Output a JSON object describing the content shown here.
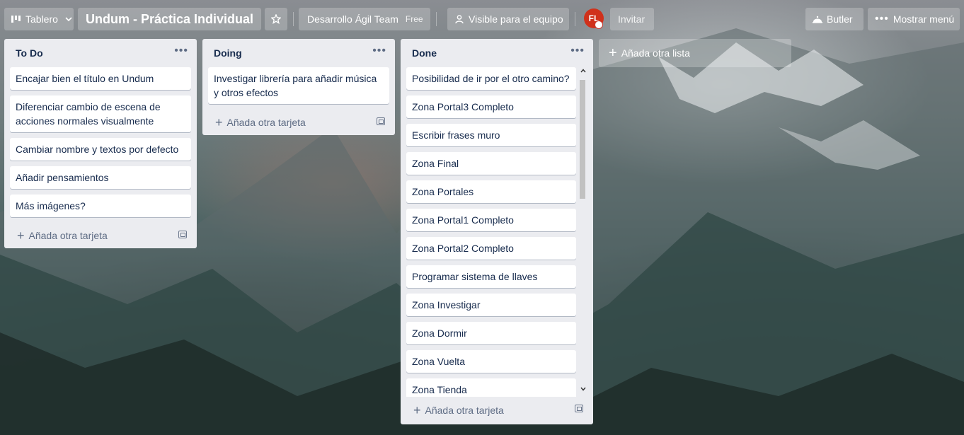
{
  "header": {
    "board_switcher": "Tablero",
    "board_title": "Undum - Práctica Individual",
    "team_name": "Desarrollo Ágil Team",
    "team_plan": "Free",
    "visibility": "Visible para el equipo",
    "avatar_initials": "FL",
    "invite": "Invitar",
    "butler": "Butler",
    "show_menu": "Mostrar menú"
  },
  "lists": [
    {
      "title": "To Do",
      "cards": [
        "Encajar bien el título en Undum",
        "Diferenciar cambio de escena de acciones normales visualmente",
        "Cambiar nombre y textos por defecto",
        "Añadir pensamientos",
        "Más imágenes?"
      ],
      "add_card": "Añada otra tarjeta"
    },
    {
      "title": "Doing",
      "cards": [
        "Investigar librería para añadir música y otros efectos"
      ],
      "add_card": "Añada otra tarjeta"
    },
    {
      "title": "Done",
      "cards": [
        "Posibilidad de ir por el otro camino?",
        "Zona Portal3 Completo",
        "Escribir frases muro",
        "Zona Final",
        "Zona Portales",
        "Zona Portal1 Completo",
        "Zona Portal2 Completo",
        "Programar sistema de llaves",
        "Zona Investigar",
        "Zona Dormir",
        "Zona Vuelta",
        "Zona Tienda"
      ],
      "add_card": "Añada otra tarjeta"
    }
  ],
  "add_list": "Añada otra lista",
  "colors": {
    "list_bg": "#ebecf0",
    "avatar_bg": "#d0311b",
    "text": "#172b4d"
  },
  "icons": {
    "board_switcher": "board-icon",
    "star": "star-icon",
    "visibility": "team-icon",
    "butler": "butler-icon",
    "menu": "ellipsis-icon",
    "template": "card-template-icon"
  }
}
